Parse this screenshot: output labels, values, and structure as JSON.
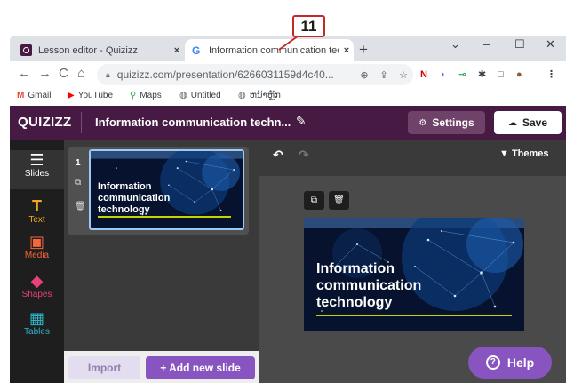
{
  "annotation": {
    "number": "11"
  },
  "browser": {
    "tabs": [
      {
        "title": "Lesson editor - Quizizz",
        "close": "×",
        "favicon": "quizizz-favicon"
      },
      {
        "title": "Information communication techn",
        "close": "×",
        "favicon": "google-favicon",
        "favicon_char": "G"
      }
    ],
    "new_tab": "+",
    "window_controls": {
      "minimize": "⌄",
      "dash": "–",
      "maximize": "☐",
      "close": "✕"
    },
    "nav": {
      "back": "←",
      "forward": "→",
      "reload": "C",
      "home": "⌂"
    },
    "address": {
      "url": "quizizz.com/presentation/6266031159d4c40..."
    },
    "extensions": [
      "N",
      "◑",
      "⊸",
      "✱",
      "□",
      "●",
      "⋮"
    ],
    "bookmarks": [
      {
        "label": "Gmail",
        "icon": "M",
        "color": "#ea4335"
      },
      {
        "label": "YouTube",
        "icon": "▶",
        "color": "#ff0000"
      },
      {
        "label": "Maps",
        "icon": "⚲",
        "color": "#34a853"
      },
      {
        "label": "Untitled",
        "icon": "◍",
        "color": "#5f6368"
      },
      {
        "label": "ຫນ້າຫຼັກ",
        "icon": "◍",
        "color": "#5f6368"
      }
    ]
  },
  "app": {
    "logo": "QUIZIZZ",
    "presentation_title": "Information communication techn...",
    "settings_label": "Settings",
    "save_label": "Save",
    "accent_color": "#461a42",
    "tools": [
      {
        "label": "Slides",
        "icon": "☰"
      },
      {
        "label": "Text",
        "icon": "T"
      },
      {
        "label": "Media",
        "icon": "▣"
      },
      {
        "label": "Shapes",
        "icon": "◆"
      },
      {
        "label": "Tables",
        "icon": "▦"
      }
    ],
    "slides": [
      {
        "number": "1",
        "text_lines": [
          "Information",
          "communication",
          "technology"
        ]
      }
    ],
    "import_label": "Import",
    "add_slide_label": "+ Add new slide",
    "themes_label": "Themes",
    "help_label": "Help",
    "main_slide_text": [
      "Information",
      "communication",
      "technology"
    ]
  }
}
